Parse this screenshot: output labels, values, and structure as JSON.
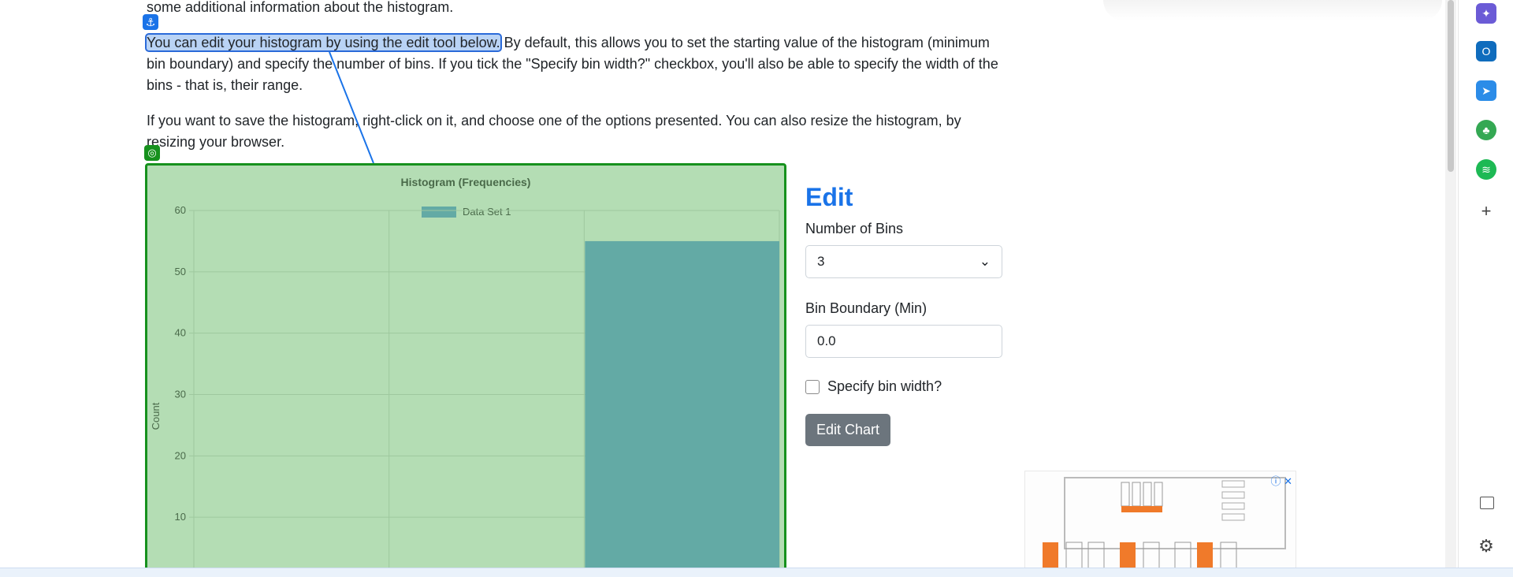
{
  "paragraphs": {
    "intro": "some additional information about the histogram.",
    "edit_highlight": "You can edit your histogram by using the edit tool below.",
    "edit_rest": " By default, this allows you to set the starting value of the histogram (minimum bin boundary) and specify the number of bins. If you tick the \"Specify bin width?\" checkbox, you'll also be able to specify the width of the bins - that is, their range.",
    "save": "If you want to save the histogram, right-click on it, and choose one of the options presented. You can also resize the histogram, by resizing your browser."
  },
  "chart_data": {
    "type": "bar",
    "title": "Histogram (Frequencies)",
    "ylabel": "Count",
    "xlabel": "",
    "ylim": [
      0,
      60
    ],
    "yticks": [
      "10",
      "20",
      "30",
      "40",
      "50",
      "60"
    ],
    "bins": 3,
    "series": [
      {
        "name": "Data Set 1",
        "values": [
          0,
          0,
          55
        ]
      }
    ],
    "grid": true,
    "legend": "top",
    "colors": {
      "bar": "#63aaa5",
      "grid": "#9ec89e",
      "background": "#b4ddb4"
    }
  },
  "edit": {
    "title": "Edit",
    "bins_label": "Number of Bins",
    "bins_value": "3",
    "boundary_label": "Bin Boundary (Min)",
    "boundary_value": "0.0",
    "checkbox_label": "Specify bin width?",
    "button_label": "Edit Chart"
  },
  "icons": {
    "anchor": "anchor-icon",
    "chart_target": "target-icon"
  },
  "sidebar": {
    "icons": [
      "copilot-icon",
      "outlook-icon",
      "send-icon",
      "tree-icon",
      "spotify-icon",
      "plus-icon",
      "panel-icon",
      "settings-icon"
    ]
  },
  "ad": {
    "label": "ⓘ ✕"
  }
}
